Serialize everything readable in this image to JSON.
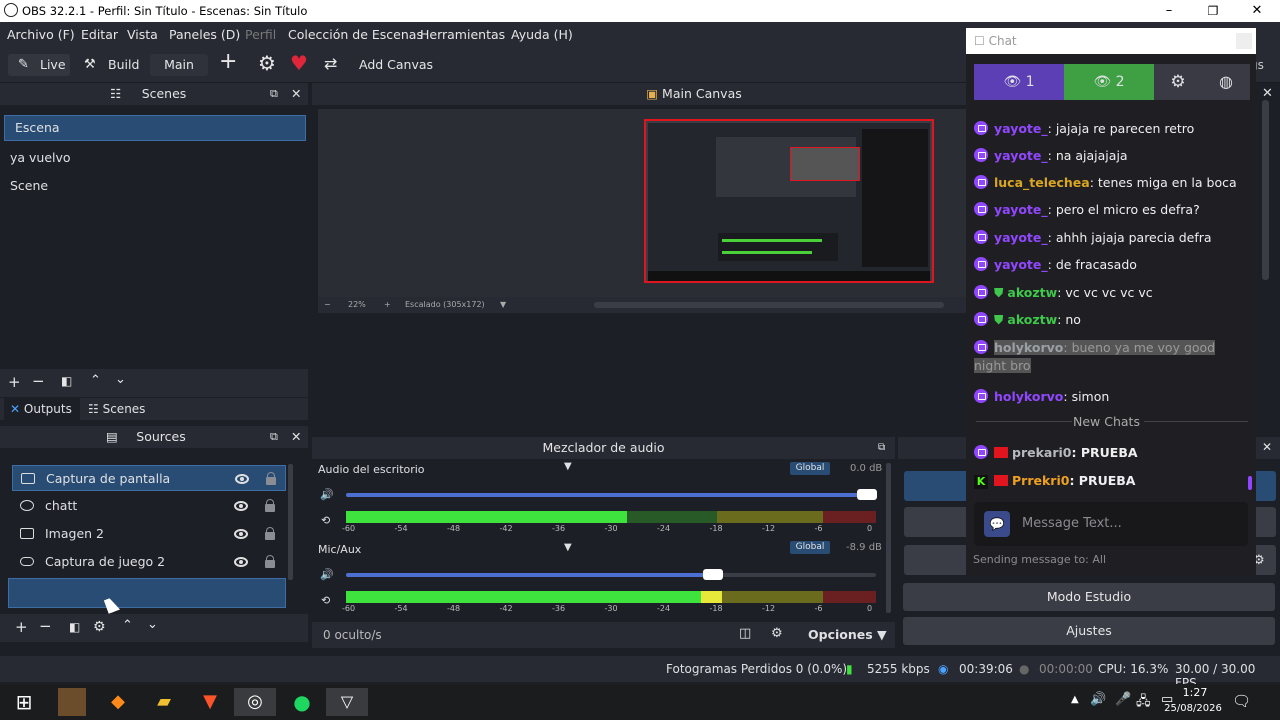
{
  "window": {
    "title": "OBS 32.2.1 - Perfil: Sin Título - Escenas: Sin Título",
    "min": "–",
    "max": "❐",
    "close": "✕"
  },
  "menu": [
    "Archivo (F)",
    "Editar",
    "Vista",
    "Paneles (D)",
    "Perfil",
    "Colección de Escenas",
    "Herramientas",
    "Ayuda (H)"
  ],
  "toolbar": {
    "live": "Live",
    "build": "Build",
    "main": "Main",
    "add_canvas": "Add Canvas"
  },
  "scenes": {
    "title": "Scenes",
    "items": [
      "Escena",
      "ya vuelvo",
      "Scene"
    ]
  },
  "tabs": {
    "outputs": "Outputs",
    "scenes": "Scenes"
  },
  "canvas": {
    "title": "Main Canvas",
    "zoom": "22%",
    "scale": "Escalado (305x172)"
  },
  "sources": {
    "title": "Sources",
    "items": [
      "Captura de pantalla",
      "chatt",
      "Imagen 2",
      "Captura de juego 2"
    ]
  },
  "mixer": {
    "title": "Mezclador de audio",
    "ch1": {
      "name": "Audio del escritorio",
      "mode": "Global",
      "db": "0.0 dB",
      "vol": 0.99
    },
    "ch2": {
      "name": "Mic/Aux",
      "mode": "Global",
      "db": "-8.9 dB",
      "vol": 0.7
    },
    "ticks": [
      "-60",
      "-54",
      "-48",
      "-42",
      "-36",
      "-30",
      "-24",
      "-18",
      "-12",
      "-6",
      "0"
    ],
    "hidden": "0 oculto/s",
    "options": "Opciones"
  },
  "controls": {
    "studio": "Modo Estudio",
    "settings": "Ajustes"
  },
  "chat": {
    "window_title": "Chat",
    "tab1": "1",
    "tab2": "2",
    "new_chats": "New Chats",
    "placeholder": "Message Text...",
    "sending": "Sending message to: All",
    "messages": [
      {
        "user": "yayote_",
        "color": "#9147ff",
        "text": ": jajaja re parecen retro"
      },
      {
        "user": "yayote_",
        "color": "#9147ff",
        "text": ": na ajajajaja"
      },
      {
        "user": "luca_telechea",
        "color": "#daa520",
        "text": ": tenes miga en la boca"
      },
      {
        "user": "yayote_",
        "color": "#9147ff",
        "text": ": pero el micro es defra?"
      },
      {
        "user": "yayote_",
        "color": "#9147ff",
        "text": ": ahhh jajaja parecia defra"
      },
      {
        "user": "yayote_",
        "color": "#9147ff",
        "text": ": de fracasado"
      },
      {
        "user": "akoztw",
        "color": "#3fc84c",
        "text": ": vc vc vc vc vc"
      },
      {
        "user": "akoztw",
        "color": "#3fc84c",
        "text": ": no"
      },
      {
        "user": "holykorvo",
        "color": "#9aa0a6",
        "text": ": bueno ya me voy good night bro"
      },
      {
        "user": "holykorvo",
        "color": "#9147ff",
        "text": ": simon"
      }
    ],
    "new_messages": [
      {
        "user": "prekari0",
        "color": "#b8b8c0",
        "text": ": PRUEBA"
      },
      {
        "user": "Prrekri0",
        "color": "#f0a020",
        "text": ": PRUEBA"
      }
    ]
  },
  "status": {
    "frames": "Fotogramas Perdidos 0 (0.0%)",
    "kbps": "5255 kbps",
    "time1": "00:39:06",
    "time2": "00:00:00",
    "cpu": "CPU: 16.3%",
    "fps": "30.00 / 30.00 FPS"
  },
  "taskbar": {
    "time": "1:27",
    "date": "25/08/2026"
  },
  "partial": {
    "right_tab": "gs"
  }
}
